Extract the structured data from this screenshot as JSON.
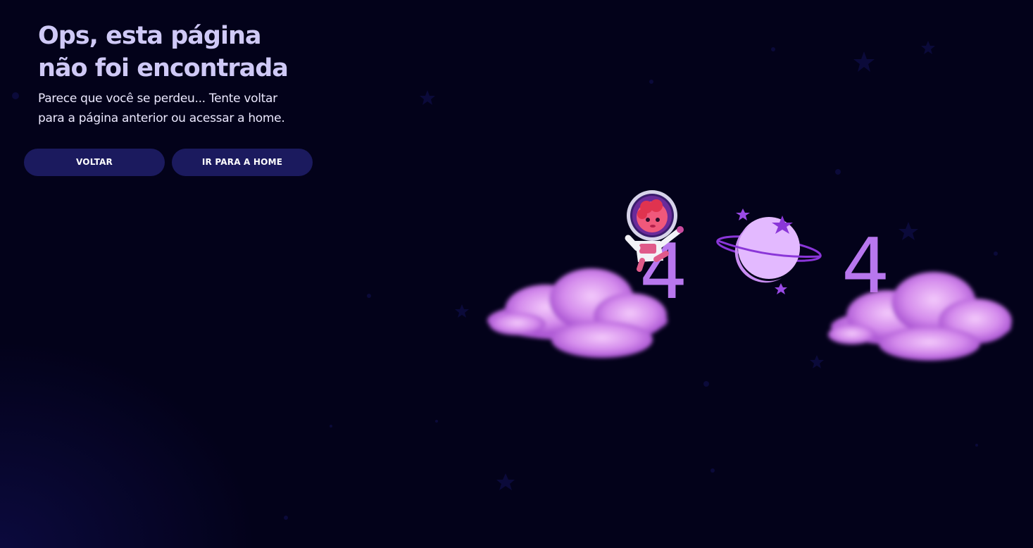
{
  "error_page": {
    "headline_line1": "Ops, esta página",
    "headline_line2": "não foi encontrada",
    "subtext_line1": "Parece que você se perdeu... Tente voltar",
    "subtext_line2": "para a página anterior ou acessar a home."
  },
  "actions": {
    "back_label": "VOLTAR",
    "home_label": "IR PARA A HOME"
  },
  "illustration": {
    "digit_left": "4",
    "digit_right": "4",
    "center_icon": "planet-icon",
    "character_icon": "astronaut-icon",
    "cloud_icon": "cloud-icon",
    "star_icon": "star-icon"
  },
  "colors": {
    "background": "#03021a",
    "headline": "#cfc9f6",
    "button_bg": "#1b1a5e",
    "accent": "#c07ff0",
    "cloud": "#d48bec"
  }
}
